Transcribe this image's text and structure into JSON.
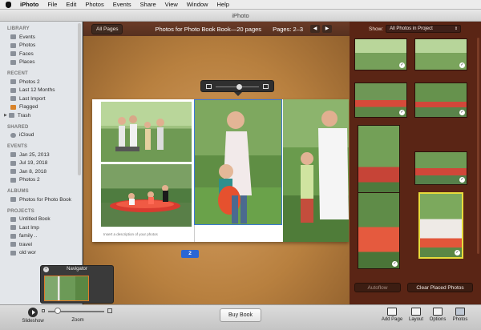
{
  "menubar": {
    "app": "iPhoto",
    "items": [
      "File",
      "Edit",
      "Photos",
      "Events",
      "Share",
      "View",
      "Window",
      "Help"
    ]
  },
  "window": {
    "title": "iPhoto"
  },
  "sidebar": {
    "library": {
      "title": "LIBRARY",
      "items": [
        "Events",
        "Photos",
        "Faces",
        "Places"
      ]
    },
    "recent": {
      "title": "RECENT",
      "items": [
        "Photos 2",
        "Last 12 Months",
        "Last Import",
        "Flagged",
        "Trash"
      ]
    },
    "shared": {
      "title": "SHARED",
      "items": [
        "iCloud"
      ]
    },
    "events": {
      "title": "EVENTS",
      "items": [
        "Jan 25, 2013",
        "Jul 19, 2018",
        "Jan 8, 2018",
        "Photos 2"
      ]
    },
    "albums": {
      "title": "ALBUMS",
      "items": [
        "Photos for Photo Book"
      ]
    },
    "projects": {
      "title": "PROJECTS",
      "items": [
        "Untitled Book",
        "Last Imp",
        "family ..",
        "travel",
        "old wor"
      ]
    }
  },
  "main": {
    "all_pages": "All Pages",
    "title": "Photos for Photo Book Book—20 pages",
    "pages": "Pages: 2–3",
    "caption": "Insert a description of your photos",
    "page_number": "2"
  },
  "navigator": {
    "title": "Navigator",
    "close": "×"
  },
  "right_panel": {
    "show_label": "Show:",
    "show_value": "All Photos in Project",
    "autoflow": "Autoflow",
    "clear_placed": "Clear Placed Photos"
  },
  "toolbar": {
    "slideshow": "Slideshow",
    "zoom": "Zoom",
    "buy_book": "Buy Book",
    "add_page": "Add Page",
    "layout": "Layout",
    "options": "Options",
    "photos": "Photos"
  },
  "colors": {
    "accent": "#2a66d3",
    "highlight": "#e7dc3c",
    "panel": "#5a2515"
  }
}
